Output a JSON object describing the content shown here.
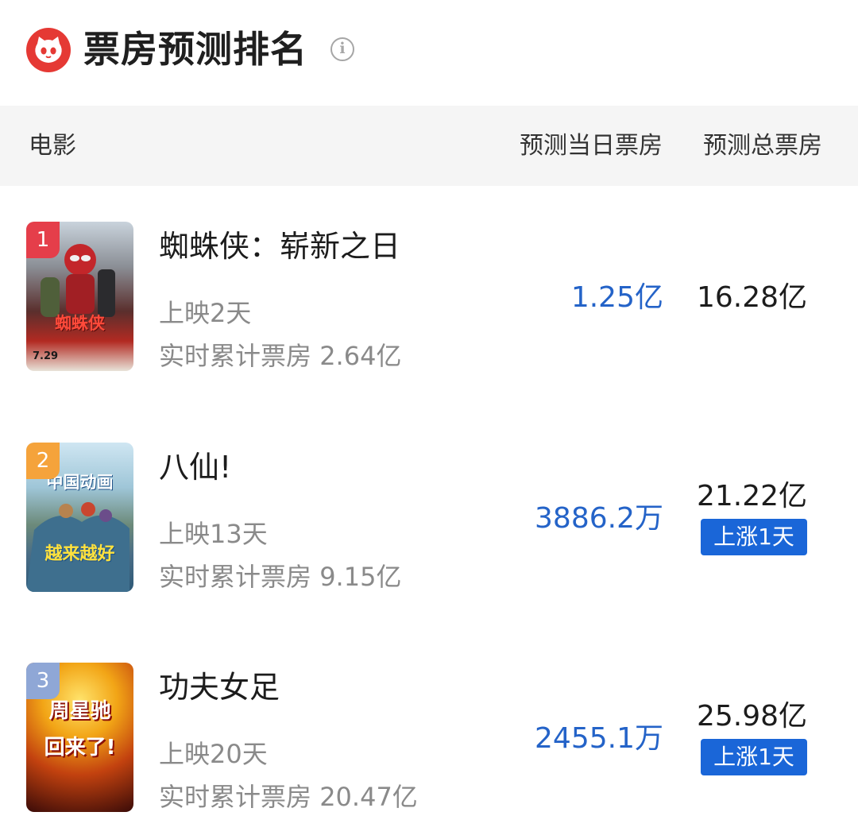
{
  "header": {
    "title": "票房预测排名",
    "info_icon": "info-icon",
    "logo_icon": "cat-logo-icon"
  },
  "columns": {
    "movie": "电影",
    "today": "预测当日票房",
    "total": "预测总票房"
  },
  "movies": [
    {
      "rank": "1",
      "rank_color": "#e53e4a",
      "name": "蜘蛛侠：崭新之日",
      "days": "上映2天",
      "cumulative_label": "实时累计票房",
      "cumulative": "2.64亿",
      "today": "1.25亿",
      "total": "16.28亿",
      "badge": null,
      "poster_text": "蜘蛛侠",
      "poster_sub": "7.29"
    },
    {
      "rank": "2",
      "rank_color": "#f5a33b",
      "name": "八仙!",
      "days": "上映13天",
      "cumulative_label": "实时累计票房",
      "cumulative": "9.15亿",
      "today": "3886.2万",
      "total": "21.22亿",
      "badge": "上涨1天",
      "poster_text": "中国动画",
      "poster_sub": "越来越好"
    },
    {
      "rank": "3",
      "rank_color": "#8fa7d6",
      "name": "功夫女足",
      "days": "上映20天",
      "cumulative_label": "实时累计票房",
      "cumulative": "20.47亿",
      "today": "2455.1万",
      "total": "25.98亿",
      "badge": "上涨1天",
      "poster_text": "周星驰",
      "poster_sub": "回来了!"
    }
  ],
  "colors": {
    "accent_blue": "#2463c8",
    "badge_blue": "#1a66d8",
    "logo_red": "#e53934"
  }
}
